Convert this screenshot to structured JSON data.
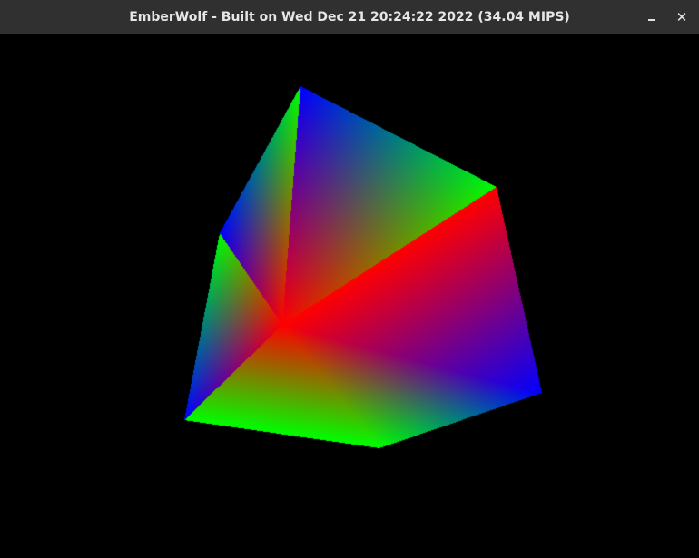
{
  "window": {
    "title": "EmberWolf - Built on Wed Dec 21 20:24:22 2022 (34.04 MIPS)",
    "minimize_icon": "minimize-icon",
    "close_icon": "close-icon",
    "close_glyph": "✕"
  },
  "colors": {
    "titlebar": "#303030",
    "viewport_background": "#000000",
    "vertex_red": "#ff0000",
    "vertex_green": "#00ff00",
    "vertex_blue": "#0000ff"
  }
}
